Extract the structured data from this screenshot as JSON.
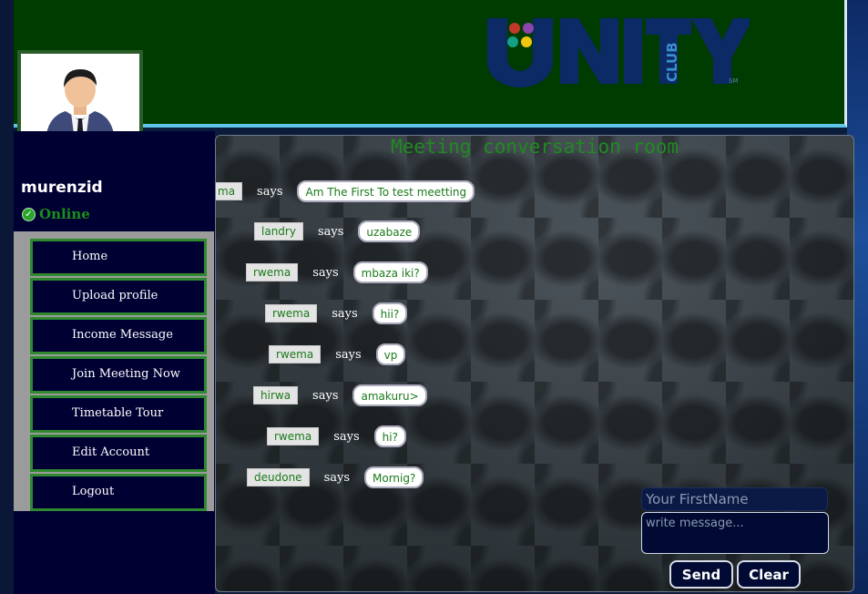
{
  "header": {
    "logo_text": "UNITY",
    "logo_sub": "CLUB",
    "logo_sm": "SM"
  },
  "user": {
    "name": "murenzid",
    "status": "Online"
  },
  "menu": {
    "items": [
      {
        "label": "Home"
      },
      {
        "label": "Upload profile"
      },
      {
        "label": "Income Message"
      },
      {
        "label": "Join Meeting Now"
      },
      {
        "label": "Timetable Tour"
      },
      {
        "label": "Edit Account"
      },
      {
        "label": "Logout"
      }
    ]
  },
  "room": {
    "title": "Meeting conversation room",
    "says_label": "says",
    "messages": [
      {
        "name": "ma",
        "text": "Am The First To test meetting"
      },
      {
        "name": "landry",
        "text": "uzabaze"
      },
      {
        "name": "rwema",
        "text": "mbaza iki?"
      },
      {
        "name": "rwema",
        "text": "hii?"
      },
      {
        "name": "rwema",
        "text": "vp"
      },
      {
        "name": "hirwa",
        "text": "amakuru>"
      },
      {
        "name": "rwema",
        "text": "hi?"
      },
      {
        "name": "deudone",
        "text": "Mornig?"
      }
    ]
  },
  "form": {
    "name_placeholder": "Your FirstName",
    "message_placeholder": "write message...",
    "send_label": "Send",
    "clear_label": "Clear"
  },
  "colors": {
    "header_bg": "#003c00",
    "sidebar_bg": "#000033",
    "accent_green": "#1f8b1f",
    "menu_border": "#2f8a2f"
  }
}
